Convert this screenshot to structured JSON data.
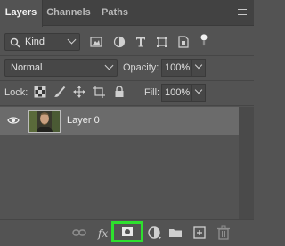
{
  "tabs": [
    {
      "label": "Layers",
      "active": true
    },
    {
      "label": "Channels",
      "active": false
    },
    {
      "label": "Paths",
      "active": false
    }
  ],
  "filter": {
    "kind_label": "Kind",
    "icons": [
      "pixel-filter-icon",
      "adjustment-filter-icon",
      "type-filter-icon",
      "shape-filter-icon",
      "smart-object-filter-icon",
      "filter-toggle-icon"
    ]
  },
  "blend": {
    "mode": "Normal",
    "opacity_label": "Opacity:",
    "opacity_value": "100%"
  },
  "lock": {
    "label": "Lock:",
    "icons": [
      "lock-transparent-pixels-icon",
      "lock-image-pixels-icon",
      "lock-position-icon",
      "lock-artboard-icon",
      "lock-all-icon"
    ],
    "fill_label": "Fill:",
    "fill_value": "100%"
  },
  "layers": [
    {
      "name": "Layer 0",
      "visible": true,
      "selected": true
    }
  ],
  "bottom_bar": {
    "icons": [
      "link-layers-icon",
      "fx-icon",
      "add-mask-icon",
      "adjustment-layer-icon",
      "group-folder-icon",
      "new-layer-icon",
      "trash-icon"
    ],
    "fx_label": "fx",
    "highlight_color": "#2ee02e"
  },
  "colors": {
    "panel_bg": "#535353",
    "selected_row": "#6b6b6b",
    "highlight": "#2ee02e"
  }
}
